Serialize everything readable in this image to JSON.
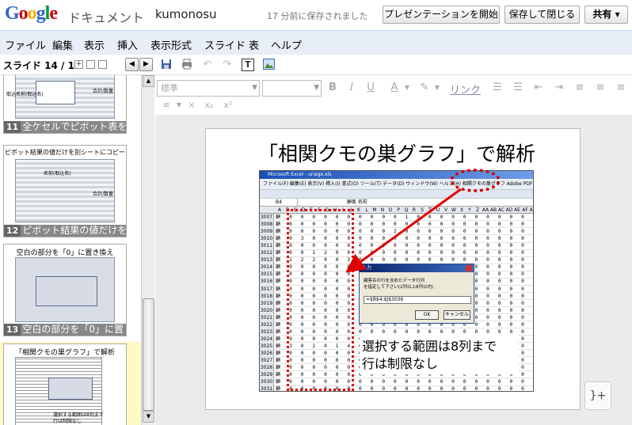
{
  "header": {
    "logo": "Google",
    "product": "ドキュメント",
    "doc_title": "kumonosu",
    "save_status": "17 分前に保存されました",
    "present_button": "プレゼンテーションを開始",
    "save_close_button": "保存して閉じる",
    "share_button": "共有 ▾",
    "logo_colors": [
      "#3366cc",
      "#cc0000",
      "#ffb000",
      "#3366cc",
      "#009933",
      "#cc0000"
    ]
  },
  "menubar": {
    "items": [
      "ファイル",
      "編集",
      "表示",
      "挿入",
      "表示形式",
      "スライド",
      "表",
      "ヘルプ"
    ]
  },
  "toolbar": {
    "slide_counter": "スライド 14 / 16",
    "add": "+",
    "prev": "◀",
    "next": "▶"
  },
  "format_toolbar": {
    "font_style": "標準",
    "font_size": "",
    "bold": "B",
    "italic": "I",
    "underline": "U",
    "text_color": "A",
    "link": "リンク",
    "sub": "x₂",
    "sup": "x²"
  },
  "thumbnails": [
    {
      "number": "11",
      "title": "",
      "caption": "全ケセルでピボット表を使う",
      "note_a": "取込名前(取込名)",
      "note_b": "合計/数量"
    },
    {
      "number": "12",
      "title": "ピボット結果の値だけを別シートにコピー",
      "caption": "ピボット結果の値だけを",
      "note_a": "名前(取込名)",
      "note_b": "合計/数量"
    },
    {
      "number": "13",
      "title": "空白の部分を「0」に置き換え",
      "caption": "空白の部分を「0」に置き"
    },
    {
      "number": "14",
      "title": "「相関クモの巣グラフ」で解析",
      "caption": "",
      "note_a": "選択する範囲は8列まで",
      "note_b": "行は制限なし"
    }
  ],
  "slide": {
    "title": "「相関クモの巣グラフ」で解析",
    "caption_line1": "選択する範囲は8列まで",
    "caption_line2": "行は制限なし",
    "screenshot": {
      "window_title": "Microsoft Excel - uriage.xls",
      "menu": "ファイル(F)  編集(E)  表示(V)  挿入(I)  書式(O)  ツール(T)  データ(D)  ウィンドウ(W)  ヘルプ(H)  相関クモの巣グラフ  Adobe PDF(B)",
      "name_box": "B4",
      "formula": "顧客 名前",
      "columns": [
        "A",
        "B",
        "C",
        "D",
        "E",
        "F",
        "G",
        "H",
        "I",
        "J",
        "K",
        "L",
        "M",
        "N",
        "O",
        "P",
        "Q",
        "R",
        "S",
        "T",
        "U",
        "V",
        "W",
        "X",
        "Y",
        "Z",
        "AA",
        "AB",
        "AC",
        "AD",
        "AE",
        "AF",
        "AG",
        "AH"
      ],
      "rows": [
        {
          "n": "3007",
          "cells": "顧 0 0 0 0 0 0 0 0 0 0 1 0 0 0 0 0 0 0 0 0 0 0 0 0 0 0"
        },
        {
          "n": "3008",
          "cells": "顧 0 0 0 0 0 0 0 0 0 0 0 0 0 0 0 0 0 0 0 0 0 0 0 0 0 0"
        },
        {
          "n": "3009",
          "cells": "顧 0 0 0 0 0 0 0 0 0 2 0 0 0 0 0 0 0 0 0 0 0 0 0 0 0 0"
        },
        {
          "n": "3010",
          "cells": "顧 0 3 0 0 0 0 0 0 0 0 0 0 0 0 0 0 0 0 0 0 0 0 0 0 0 0"
        },
        {
          "n": "3011",
          "cells": "顧 0 0 0 0 0 0 0 0 0 0 0 0 0 0 0 0 0 0 0 0 0 0 0 0 0 0"
        },
        {
          "n": "3012",
          "cells": "顧 0 0 1 2 0 0 0 0 0 0 0 0 0 0 0 0 0 0 0 0 0 0 0 0 0 0"
        },
        {
          "n": "3013",
          "cells": "顧 2 2 2 0 0 3 0 0 0 0 0 0 0 0 0 0 0 0 0 0 0 0 0 0 0 0"
        },
        {
          "n": "3014",
          "cells": "顧 0 0 0 0 0 0 0 0 0 0 0 0 0 0 0 0 0 0 0 0 0 0 0 0 0 0"
        },
        {
          "n": "3015",
          "cells": "顧 0 0 0 0 0 0 0 0 0 0 0 0 0 0 0 0 0 0 0 0 0 0 0 0 0 0"
        },
        {
          "n": "3016",
          "cells": "顧 0 0 0 0 0 0 0 0 0 0 0 0 0 0 0 0 0 0 0 0 0 0 0 0 0 0"
        },
        {
          "n": "3017",
          "cells": "顧 0 0 0 0 0 0 0 0 0 0 0 0 0 0 0 0 0 0 0 0 0 0 0 0 0 0"
        },
        {
          "n": "3018",
          "cells": "顧 0 0 0 0 0 0 0 0 0 0 0 0 0 0 0 0 0 0 0 0 0 0 0 0 0 0"
        },
        {
          "n": "3019",
          "cells": "顧 0 0 0 0 0 0 0 0 0 0 0 0 0 0 0 0 0 0 0 0 0 0 0 0 0 0"
        },
        {
          "n": "3020",
          "cells": "顧 0 0 0 0 0 0 0 0 0 0 0 0 0 0 0 0 0 0 0 0 0 0 0 0 0 0"
        },
        {
          "n": "3021",
          "cells": "顧 0 0 0 0 0 0 0 0 0 0 0 0 0 0 0 0 0 0 0 0 0 0 0 0 0 0"
        },
        {
          "n": "3022",
          "cells": "顧 0 0 0 0 0 0 0 0 0 0 0 0 0 0 0 0 0 0 0 0 0 0 0 0 0 0"
        },
        {
          "n": "3023",
          "cells": "顧 0 0 0 0 0 0 0 0 0 0 0 0 0 0 0 0 0 0 0 0 0 0 0 0 0 0"
        },
        {
          "n": "3024",
          "cells": "顧 0 0 0 0 0 0 0 0 0 0 0 0 0 0 0 0 0 0 0 0 0 0 0 0 0 0"
        },
        {
          "n": "3025",
          "cells": "顧 3 0 1 0 1 4 0 1 0 0 0 0 0 0 0 0 0 0 0 0 0 0 0 0 0 0"
        },
        {
          "n": "3026",
          "cells": "顧 0 0 0 0 0 0 0 0 0 0 0 0 0 0 0 0 0 0 0 0 0 0 0 0 0 0"
        },
        {
          "n": "3027",
          "cells": "顧 0 0 0 0 0 0 0 0 0 0 0 0 0 0 0 0 0 0 0 0 0 0 0 0 0 0"
        },
        {
          "n": "3028",
          "cells": "顧 0 0 0 0 0 0 0 0 0 0 0 0 0 0 0 0 0 0 0 0 0 0 0 0 0 0"
        },
        {
          "n": "3029",
          "cells": "顧 0 0 0 0 0 0 0 0 0 0 0 0 0 0 0 0 0 0 0 0 0 0 0 0 0 0"
        },
        {
          "n": "3030",
          "cells": "顧 0 0 0 0 0 0 0 0 0 0 0 0 0 0 0 0 0 0 0 0 0 0 0 0 0 0"
        },
        {
          "n": "3031",
          "cells": "顧 0 0 0 0 0 0 0 0 0 0 0 0 0 0 0 0 0 0 0 0 0 0 0 0 0 0"
        }
      ],
      "dialog": {
        "title": "入力",
        "prompt1": "顧客名の行を含めたデータ行列",
        "prompt2": "を指定して下さい(2列以上8列以内)",
        "input_value": "=$B$4:$J$3036",
        "ok": "OK",
        "cancel": "キャンセル"
      }
    }
  },
  "colors": {
    "menubar_bg": "#e8eef7",
    "annotation_red": "#e00000",
    "selected_thumb_bg": "#fff9c4"
  }
}
